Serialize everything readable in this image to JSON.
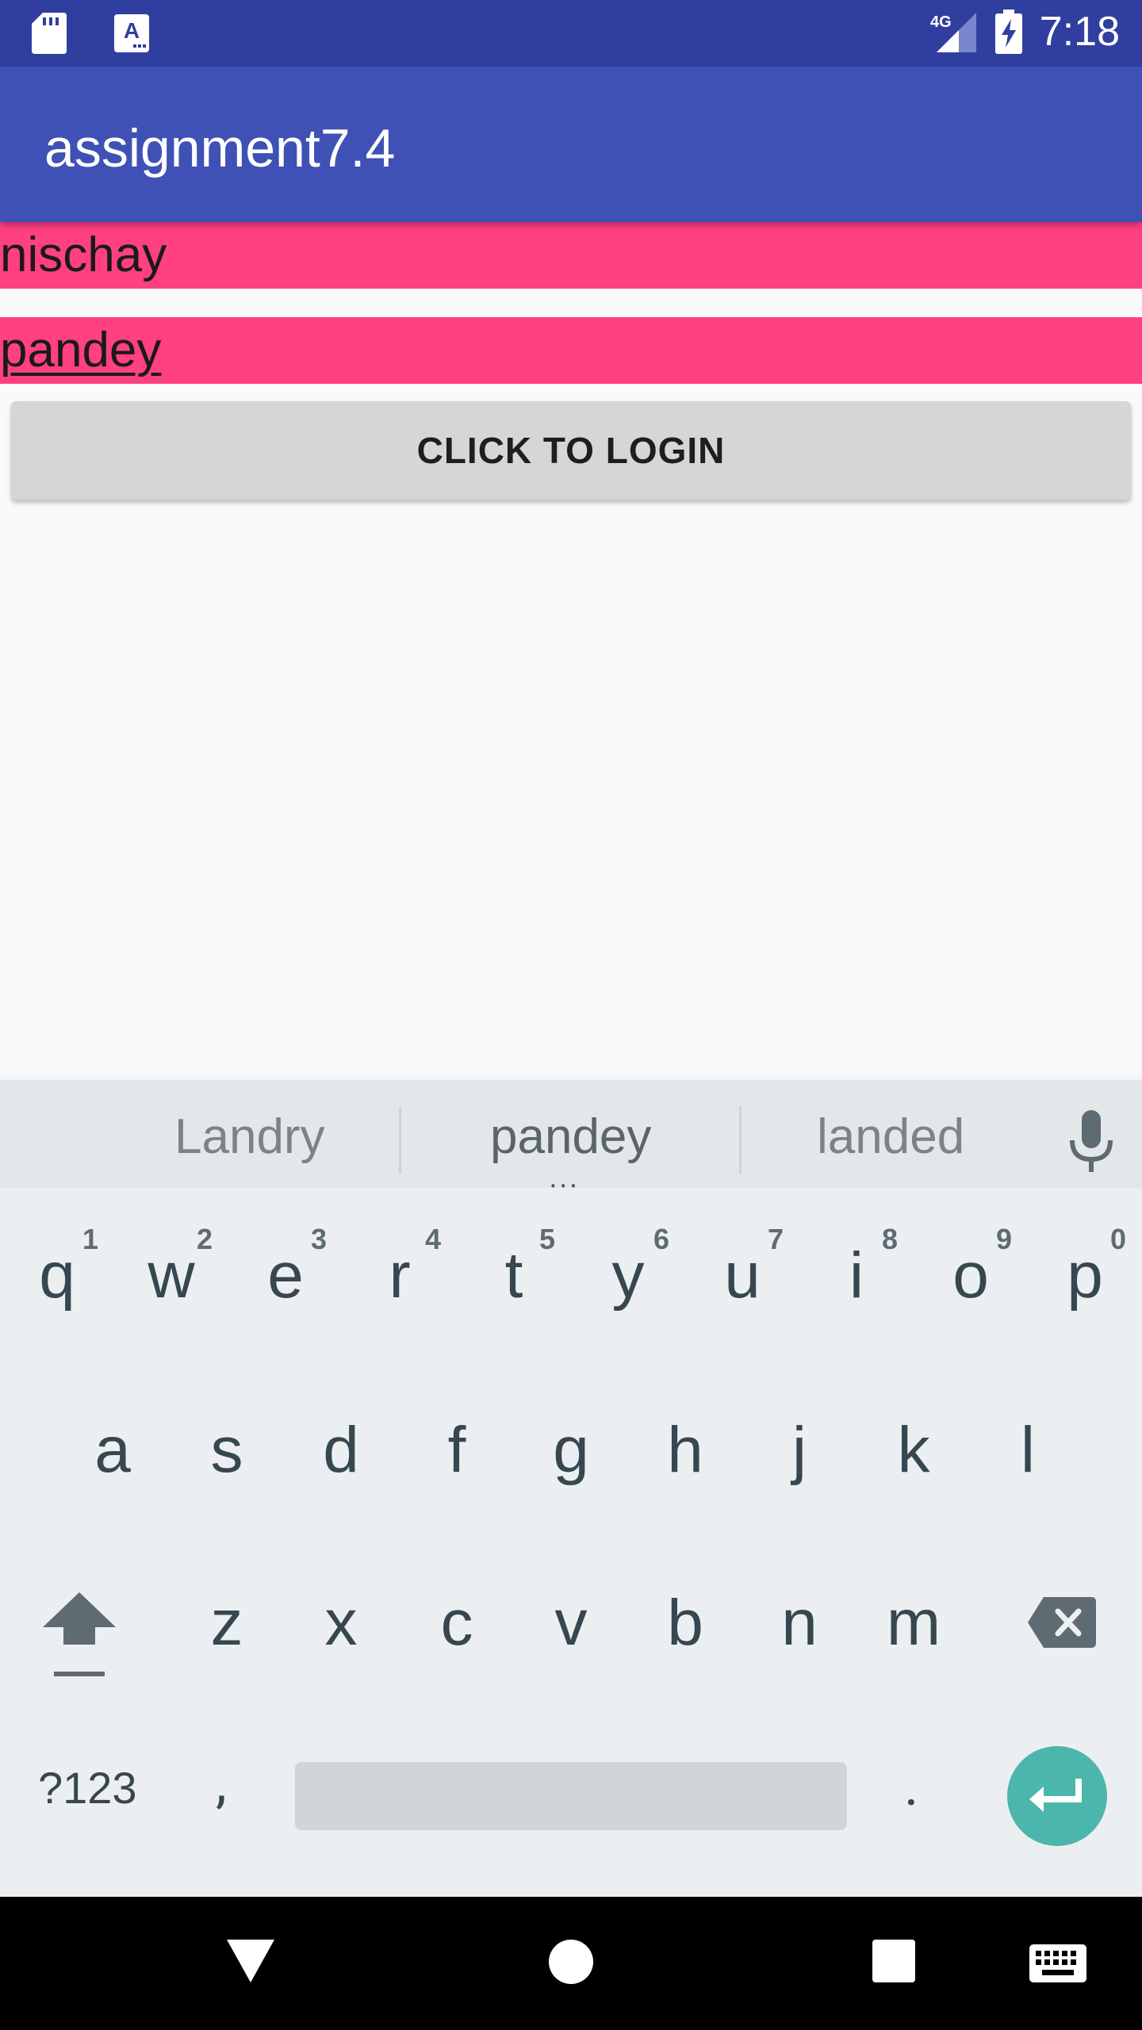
{
  "status_bar": {
    "time": "7:18",
    "network": "4G",
    "icons": [
      "sd-card-icon",
      "text-notification-icon",
      "signal-icon",
      "battery-charging-icon"
    ]
  },
  "app_bar": {
    "title": "assignment7.4"
  },
  "form": {
    "username_value": "nischay",
    "password_value": "pandey",
    "login_label": "CLICK TO LOGIN"
  },
  "keyboard": {
    "suggestions": [
      "Landry",
      "pandey",
      "landed"
    ],
    "row1": [
      {
        "key": "q",
        "hint": "1"
      },
      {
        "key": "w",
        "hint": "2"
      },
      {
        "key": "e",
        "hint": "3"
      },
      {
        "key": "r",
        "hint": "4"
      },
      {
        "key": "t",
        "hint": "5"
      },
      {
        "key": "y",
        "hint": "6"
      },
      {
        "key": "u",
        "hint": "7"
      },
      {
        "key": "i",
        "hint": "8"
      },
      {
        "key": "o",
        "hint": "9"
      },
      {
        "key": "p",
        "hint": "0"
      }
    ],
    "row2": [
      "a",
      "s",
      "d",
      "f",
      "g",
      "h",
      "j",
      "k",
      "l"
    ],
    "row3": [
      "z",
      "x",
      "c",
      "v",
      "b",
      "n",
      "m"
    ],
    "symbols_label": "?123",
    "comma": ",",
    "period": "."
  },
  "colors": {
    "status_bar": "#303f9f",
    "app_bar": "#3f51b5",
    "field_bg": "#ff4081",
    "button_bg": "#d6d6d6",
    "enter_key": "#4db6ac"
  }
}
